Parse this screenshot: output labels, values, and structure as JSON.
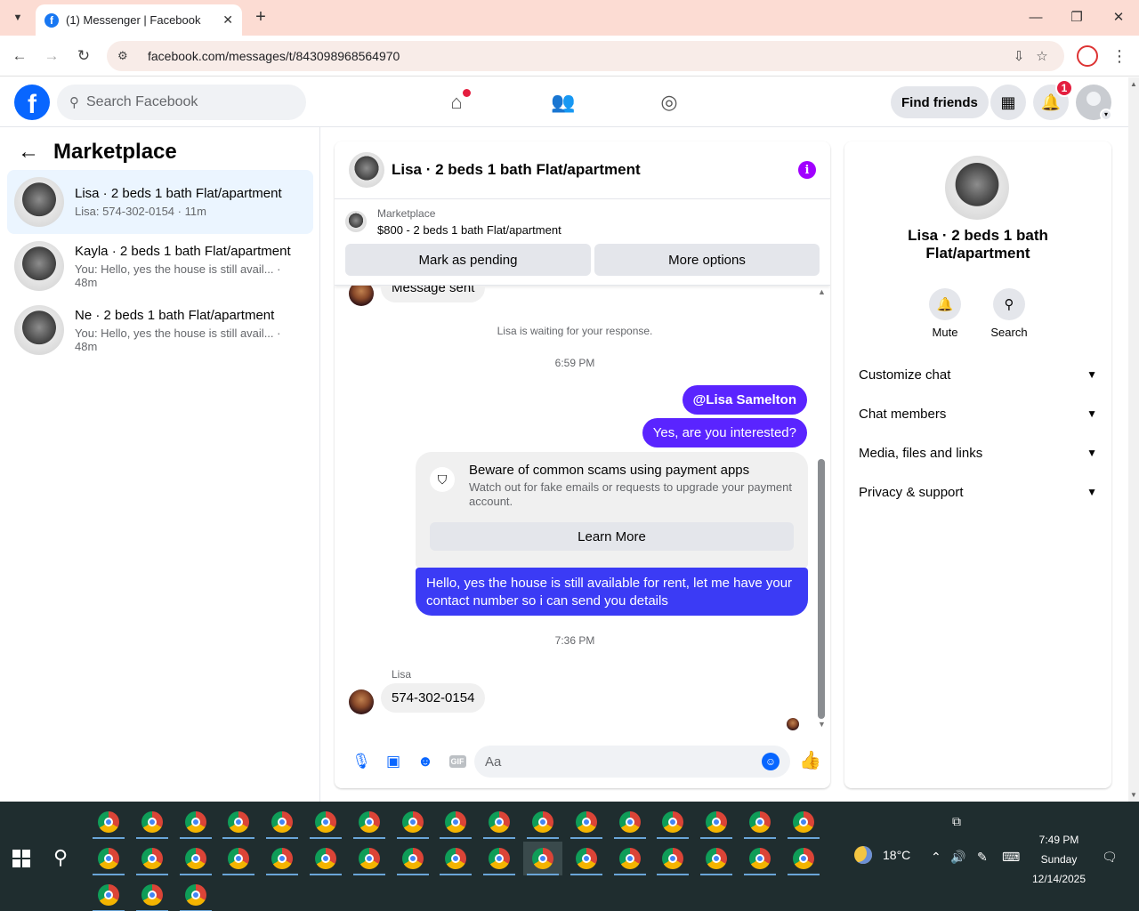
{
  "browser": {
    "tab_title": "(1) Messenger | Facebook",
    "url": "facebook.com/messages/t/843098968564970"
  },
  "fb": {
    "search_placeholder": "Search Facebook",
    "find_friends": "Find friends",
    "notifications_count": "1"
  },
  "left": {
    "title": "Marketplace",
    "conversations": [
      {
        "name": "Lisa · 2 beds 1 bath Flat/apartment",
        "snippet": "Lisa: 574-302-0154 · 11m",
        "active": true
      },
      {
        "name": "Kayla · 2 beds 1 bath Flat/apartment",
        "snippet": "You: Hello, yes the house is still avail... · 48m",
        "active": false
      },
      {
        "name": "Ne · 2 beds 1 bath Flat/apartment",
        "snippet": "You: Hello, yes the house is still avail... · 48m",
        "active": false
      }
    ]
  },
  "chat": {
    "title": "Lisa · 2 beds 1 bath Flat/apartment",
    "listing_label": "Marketplace",
    "listing_price": "$800 - 2 beds 1 bath Flat/apartment",
    "mark_pending": "Mark as pending",
    "more_options": "More options",
    "partial_message": "Message sent",
    "waiting": "Lisa is waiting for your response.",
    "time1": "6:59 PM",
    "mention": "@Lisa Samelton",
    "question": "Yes, are you interested?",
    "scam_title": "Beware of common scams using payment apps",
    "scam_body": "Watch out for fake emails or requests to upgrade your payment account.",
    "learn_more": "Learn More",
    "long_message": "Hello, yes the house is still available for rent, let me have your contact number so i can send you details",
    "time2": "7:36 PM",
    "sender": "Lisa",
    "reply": "574-302-0154",
    "composer_placeholder": "Aa"
  },
  "right": {
    "name": "Lisa · 2 beds 1 bath Flat/apartment",
    "mute": "Mute",
    "search": "Search",
    "sections": [
      "Customize chat",
      "Chat members",
      "Media, files and links",
      "Privacy & support"
    ]
  },
  "taskbar": {
    "temperature": "18°C",
    "time": "7:49 PM",
    "day": "Sunday",
    "date": "12/14/2025"
  }
}
